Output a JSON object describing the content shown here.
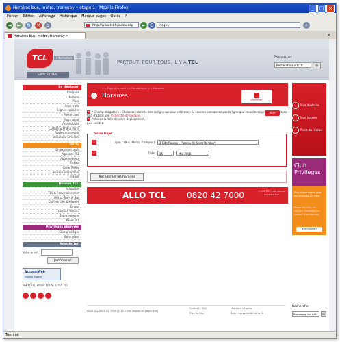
{
  "browser": {
    "title": "Horaires bus, métro, tramway • etape 1 - Mozilla Firefox",
    "menu": [
      "Fichier",
      "Édition",
      "Affichage",
      "Historique",
      "Marque-pages",
      "Outils",
      "?"
    ],
    "url": "http://www.tcl.fr/index.asp",
    "search_value": "nogeo",
    "tab_label": "Horaires bus, métro, tramway •",
    "status": "Terminé"
  },
  "header": {
    "logo": "TCL",
    "logo_sub": "information",
    "tagline_prefix": "PARTOUT, POUR TOUS, IL Y A",
    "tagline_brand": "TCL",
    "filter_label": "Filter  SYTRAL",
    "search_label": "Rechercher",
    "search_placeholder": "Recherche sur tcl.fr",
    "search_ok": "OK"
  },
  "sidebar": {
    "sections": [
      {
        "title": "Se déplacer",
        "color": "#d8202a",
        "items": [
          "Itinéraire",
          "Horaires",
          "Plans",
          "Infos trafic",
          "Lignes scolaires",
          "Pleine Lune",
          "Parcs relais",
          "Accessibilité",
          "Culture & Rhône Parcs",
          "Règles et conseils",
          "Nouveaux arrivants"
        ]
      },
      {
        "title": "Tarifs",
        "color": "#f28c1a",
        "items": [
          "Choix selon profil",
          "Agences TCL",
          "Abonnements",
          "Tickets",
          "Carte Técély",
          "Espace entreprises",
          "Fraude"
        ]
      },
      {
        "title": "Réseau TCL",
        "color": "#3a9a3a",
        "items": [
          "Actualités",
          "TCL & l'environnement",
          "Métro, Tram & Bus",
          "Chiffres clés & Histoire",
          "Emploi",
          "Gestion Réseau",
          "Espace presse",
          "Panel TCL"
        ]
      },
      {
        "title": "Privilèges abonnés",
        "color": "#9a2a7a",
        "items": [
          "Club privilèges",
          "Bons plans"
        ]
      },
      {
        "title": "Newsletter",
        "color": "#6a7488",
        "items": []
      }
    ],
    "newsletter_label": "Votre email :",
    "newsletter_button": "Je m'inscris !",
    "accessweb": "AccessiWeb",
    "accessweb_sub": "Niveau Argent",
    "partout": "PARTOUT, POUR TOUS, IL Y A TCL"
  },
  "main": {
    "breadcrumb": ">> Page d'accueil  >> Se déplacer  >> Horaires",
    "title": "Horaires",
    "imprimer": "Imprimer",
    "help_line1": "* Champ obligatoire : Choisissez dans la liste la ligne qui vous intéresse. Si vous ne connaissez pas la ligne que vous devez prendre, effectuez tout d'abord une",
    "help_link": "recherche d'itinéraire.",
    "help_line2": "Précisez la date de votre déplacement,",
    "help_line3": "puis validez.",
    "aide_label": "Aide",
    "trajet_legend": "Votre trajet",
    "ligne_label": "Ligne * (Bus, Métro, Tramway)",
    "ligne_value": "2 Cite Rousse - Plateau de Saint Rambert",
    "date_label": "Date",
    "date_day": "26",
    "date_month": "Mai 2008",
    "search_button": "Rechercher les horaires",
    "allo_label": "ALLO TCL",
    "allo_number": "0820 42 7000",
    "allo_note": "0,12€ TTC / min depuis un poste fixe"
  },
  "rside": {
    "links": [
      "Mon itinéraire",
      "Mon horaire",
      "Plans du réseau"
    ],
    "club_title": "Club Privilèges",
    "club_sub": "Plus d'avantages pour les abonnés Clé Pass",
    "club_text": "Pages Bonnes, de Samuel Privilèges en conseil à rechercher",
    "club_button": "Je m'inscris !"
  },
  "footer": {
    "text": "ALLO TCL 0820 42 7000 (0,12 € min depuis un poste fixe)",
    "links": [
      "Contact - FAQ",
      "Plan du Site",
      "Mentions Légales",
      "Aide : accessibilité de tcl.fr"
    ]
  }
}
